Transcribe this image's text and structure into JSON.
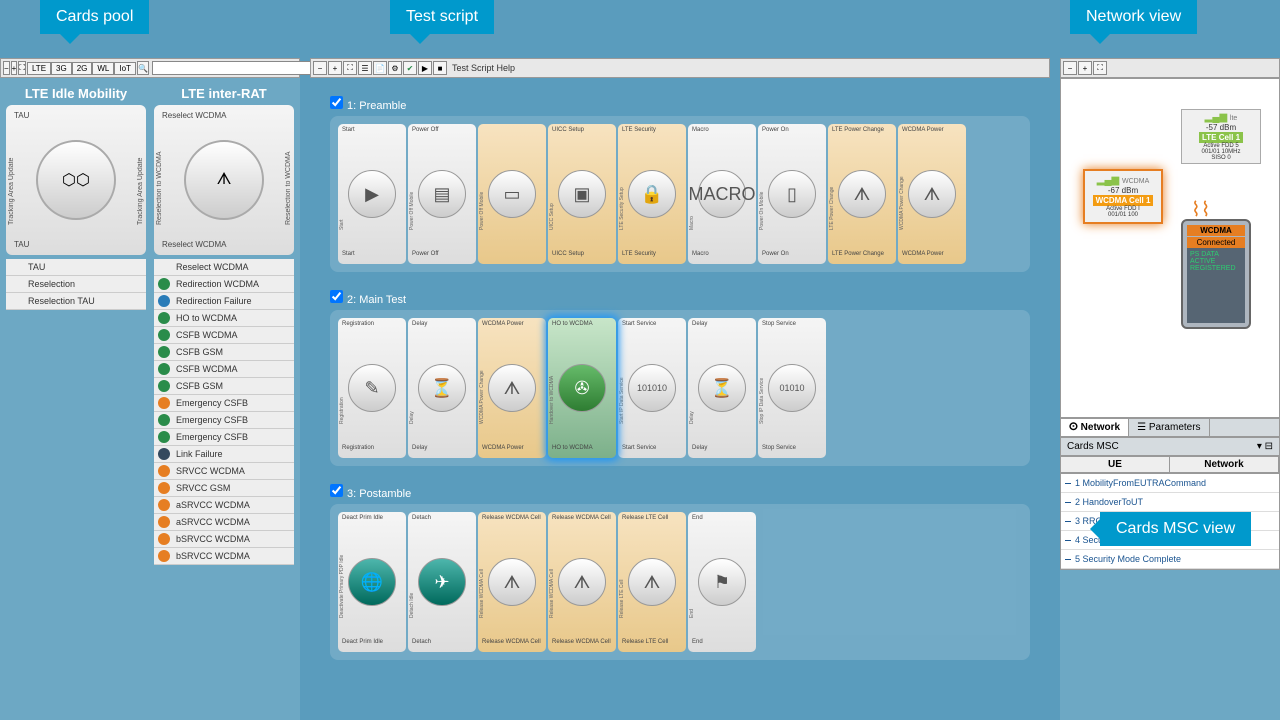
{
  "callouts": {
    "cards_pool": "Cards pool",
    "test_script": "Test script",
    "network_view": "Network view",
    "cards_msc": "Cards MSC view"
  },
  "cards_pool": {
    "filters": [
      "LTE",
      "3G",
      "2G",
      "WL",
      "IoT"
    ],
    "categories": [
      {
        "title": "LTE Idle Mobility",
        "main_card": {
          "header": "TAU",
          "footer": "TAU",
          "side_left": "Tracking Area Update",
          "side_right": "Tracking Area Update"
        },
        "items": [
          {
            "label": "TAU",
            "color": "white"
          },
          {
            "label": "Reselection",
            "color": "white"
          },
          {
            "label": "Reselection TAU",
            "color": "white"
          }
        ]
      },
      {
        "title": "LTE inter-RAT",
        "main_card": {
          "header": "Reselect WCDMA",
          "footer": "Reselect WCDMA",
          "side_left": "Reselection to WCDMA",
          "side_right": "Reselection to WCDMA"
        },
        "items": [
          {
            "label": "Reselect WCDMA",
            "color": "white"
          },
          {
            "label": "Redirection WCDMA",
            "color": "green"
          },
          {
            "label": "Redirection Failure",
            "color": "blue"
          },
          {
            "label": "HO to WCDMA",
            "color": "green"
          },
          {
            "label": "CSFB WCDMA",
            "color": "green"
          },
          {
            "label": "CSFB GSM",
            "color": "green"
          },
          {
            "label": "CSFB WCDMA",
            "color": "green"
          },
          {
            "label": "CSFB GSM",
            "color": "green"
          },
          {
            "label": "Emergency CSFB",
            "color": "orange"
          },
          {
            "label": "Emergency CSFB",
            "color": "green"
          },
          {
            "label": "Emergency CSFB",
            "color": "green"
          },
          {
            "label": "Link Failure",
            "color": "dark"
          },
          {
            "label": "SRVCC WCDMA",
            "color": "orange"
          },
          {
            "label": "SRVCC GSM",
            "color": "orange"
          },
          {
            "label": "aSRVCC WCDMA",
            "color": "orange"
          },
          {
            "label": "aSRVCC WCDMA",
            "color": "orange"
          },
          {
            "label": "bSRVCC WCDMA",
            "color": "orange"
          },
          {
            "label": "bSRVCC WCDMA",
            "color": "orange"
          }
        ]
      }
    ]
  },
  "test_script": {
    "help_label": "Test Script Help",
    "groups": [
      {
        "title": "1: Preamble",
        "cards": [
          {
            "top": "Start",
            "bot": "Start",
            "vt": "Start",
            "tint": "",
            "icon": "play"
          },
          {
            "top": "Power Off",
            "bot": "Power Off",
            "vt": "Power Off Mobile",
            "tint": "",
            "icon": "servers"
          },
          {
            "top": "",
            "bot": "",
            "vt": "Power Off Mobile",
            "tint": "orange-bg",
            "icon": "phone-off"
          },
          {
            "top": "UICC Setup",
            "bot": "UICC Setup",
            "vt": "UICC Setup",
            "tint": "orange-bg",
            "icon": "sim"
          },
          {
            "top": "LTE Security",
            "bot": "LTE Security",
            "vt": "LTE Security Setup",
            "tint": "orange-bg",
            "icon": "lock"
          },
          {
            "top": "Macro",
            "bot": "Macro",
            "vt": "Macro",
            "tint": "",
            "icon": "macro"
          },
          {
            "top": "Power On",
            "bot": "Power On",
            "vt": "Power On Mobile",
            "tint": "",
            "icon": "phone-on"
          },
          {
            "top": "LTE Power Change",
            "bot": "LTE Power Change",
            "vt": "LTE Power Change",
            "tint": "orange-bg",
            "icon": "antenna"
          },
          {
            "top": "WCDMA Power",
            "bot": "WCDMA Power",
            "vt": "WCDMA Power Change",
            "tint": "orange-bg",
            "icon": "antenna"
          }
        ]
      },
      {
        "title": "2: Main Test",
        "cards": [
          {
            "top": "Registration",
            "bot": "Registration",
            "vt": "Registration",
            "tint": "",
            "icon": "sheet"
          },
          {
            "top": "Delay",
            "bot": "Delay",
            "vt": "Delay",
            "tint": "",
            "icon": "hourglass"
          },
          {
            "top": "WCDMA Power",
            "bot": "WCDMA Power",
            "vt": "WCDMA Power Change",
            "tint": "orange-bg",
            "icon": "antenna"
          },
          {
            "top": "HO to WCDMA",
            "bot": "HO to WCDMA",
            "vt": "Handover to WCDMA",
            "tint": "green-bg highlight",
            "icon": "handover",
            "circle": "green"
          },
          {
            "top": "Start Service",
            "bot": "Start Service",
            "vt": "Start IP Data Service",
            "tint": "",
            "icon": "binary-play"
          },
          {
            "top": "Delay",
            "bot": "Delay",
            "vt": "Delay",
            "tint": "",
            "icon": "hourglass"
          },
          {
            "top": "Stop Service",
            "bot": "Stop Service",
            "vt": "Stop IP Data Service",
            "tint": "",
            "icon": "binary-stop"
          }
        ]
      },
      {
        "title": "3: Postamble",
        "cards": [
          {
            "top": "Deact Prim Idle",
            "bot": "Deact Prim Idle",
            "vt": "Deactivate Primary PDP Idle",
            "tint": "",
            "icon": "globe",
            "circle": "teal"
          },
          {
            "top": "Detach",
            "bot": "Detach",
            "vt": "Detach Idle",
            "tint": "",
            "icon": "detach",
            "circle": "teal"
          },
          {
            "top": "Release WCDMA Cell",
            "bot": "Release WCDMA Cell",
            "vt": "Release WCDMA Cell",
            "tint": "orange-bg",
            "icon": "antenna-grey"
          },
          {
            "top": "Release WCDMA Cell",
            "bot": "Release WCDMA Cell",
            "vt": "Release WCDMA Cell",
            "tint": "orange-bg",
            "icon": "antenna-grey"
          },
          {
            "top": "Release LTE Cell",
            "bot": "Release LTE Cell",
            "vt": "Release LTE Cell",
            "tint": "orange-bg",
            "icon": "antenna-grey"
          },
          {
            "top": "End",
            "bot": "End",
            "vt": "End",
            "tint": "",
            "icon": "flag"
          }
        ]
      }
    ]
  },
  "network_view": {
    "lte": {
      "rat": "lte",
      "power": "-57 dBm",
      "name": "LTE Cell 1",
      "line1": "Active  FDD 5",
      "line2": "001/01  10MHz",
      "line3": "SISO  0"
    },
    "wcdma": {
      "rat": "WCDMA",
      "power": "-67 dBm",
      "name": "WCDMA Cell 1",
      "line1": "Active  FDD I",
      "line2": "001/01  100"
    },
    "phone": {
      "rat": "WCDMA",
      "status": "Connected",
      "detail": "PS DATA\nACTIVE\nREGISTERED"
    },
    "tabs": [
      "Network",
      "Parameters"
    ],
    "msc_title": "Cards MSC",
    "msc_cols": [
      "UE",
      "Network"
    ],
    "msc_items": [
      "1 MobilityFromEUTRACommand",
      "2 HandoverToUT",
      "3 RRCConnection",
      "4 Security Mode Command",
      "5 Security Mode Complete"
    ]
  }
}
